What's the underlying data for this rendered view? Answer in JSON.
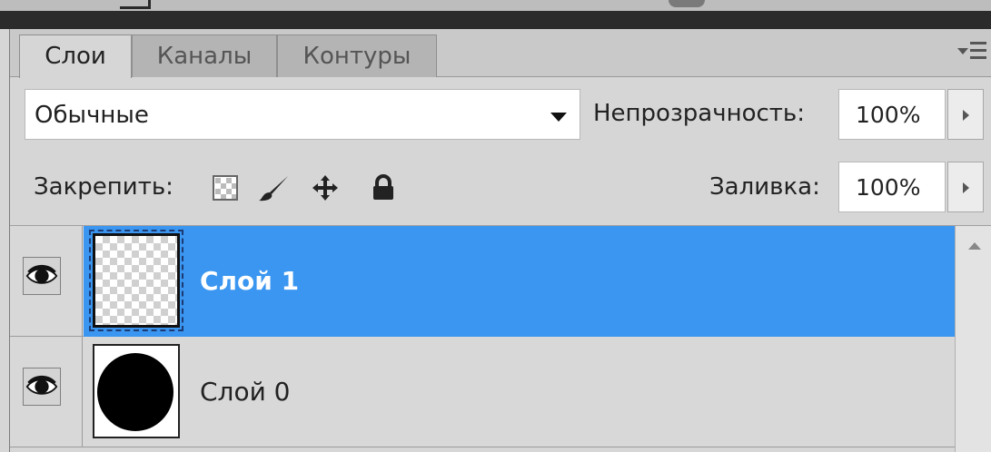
{
  "tabs": [
    {
      "label": "Слои",
      "active": true
    },
    {
      "label": "Каналы",
      "active": false
    },
    {
      "label": "Контуры",
      "active": false
    }
  ],
  "blend_mode": {
    "value": "Обычные"
  },
  "opacity": {
    "label": "Непрозрачность:",
    "value": "100%"
  },
  "lock": {
    "label": "Закрепить:",
    "icons": [
      "lock-transparency-icon",
      "brush-icon",
      "move-icon",
      "padlock-icon"
    ]
  },
  "fill": {
    "label": "Заливка:",
    "value": "100%"
  },
  "layers": [
    {
      "name": "Слой 1",
      "selected": true,
      "thumbnail": "transparent"
    },
    {
      "name": "Слой 0",
      "selected": false,
      "thumbnail": "black-circle"
    }
  ],
  "colors": {
    "selection": "#3a96f0",
    "panel": "#d6d6d6"
  }
}
